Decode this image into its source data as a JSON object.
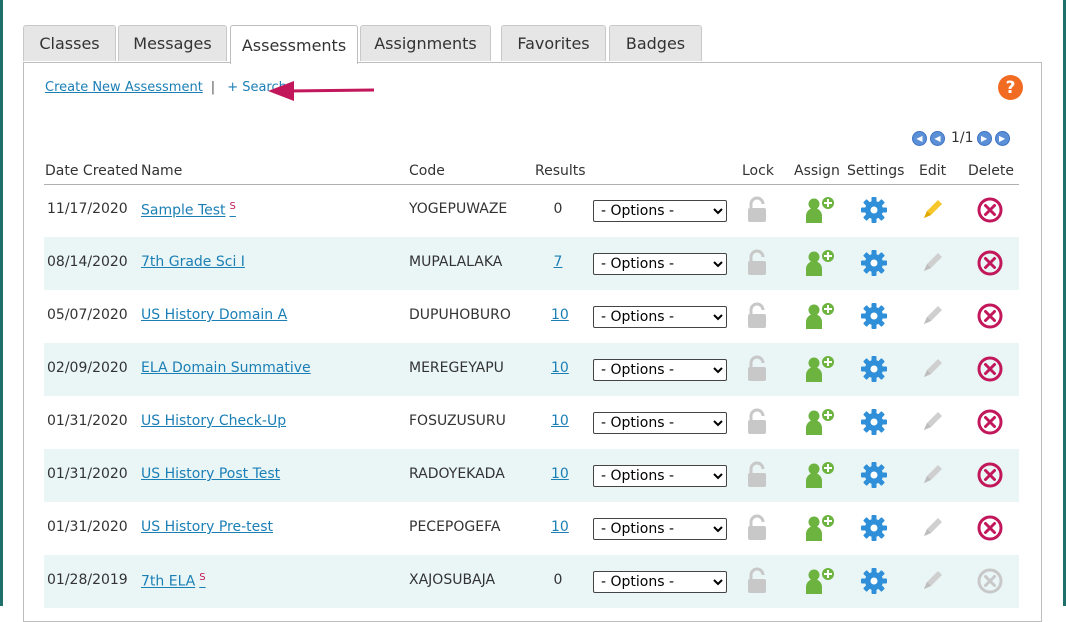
{
  "tabs": [
    "Classes",
    "Messages",
    "Assessments",
    "Assignments",
    "Favorites",
    "Badges"
  ],
  "active_tab": "Assessments",
  "links": {
    "create": "Create New Assessment",
    "separator": "|",
    "search": "+ Search"
  },
  "help": {
    "label": "?",
    "color": "#f26b22"
  },
  "pager": {
    "text": "1/1"
  },
  "columns": {
    "date": "Date Created",
    "name": "Name",
    "code": "Code",
    "results": "Results",
    "lock": "Lock",
    "assign": "Assign",
    "settings": "Settings",
    "edit": "Edit",
    "delete": "Delete"
  },
  "options_label": "- Options -",
  "colors": {
    "accent": "#1b7fb6",
    "assign": "#6cb33f",
    "settings": "#2f8fd8",
    "delete": "#c2185b",
    "edit_active": "#f6c62b",
    "arrow": "#c2185b"
  },
  "rows": [
    {
      "date": "11/17/2020",
      "name": "Sample Test",
      "sup": "S",
      "code": "YOGEPUWAZE",
      "results": "0",
      "results_link": false,
      "edit_active": true,
      "delete_active": true
    },
    {
      "date": "08/14/2020",
      "name": "7th Grade Sci I",
      "sup": "",
      "code": "MUPALALAKA",
      "results": "7",
      "results_link": true,
      "edit_active": false,
      "delete_active": true
    },
    {
      "date": "05/07/2020",
      "name": "US History Domain A",
      "sup": "",
      "code": "DUPUHOBURO",
      "results": "10",
      "results_link": true,
      "edit_active": false,
      "delete_active": true
    },
    {
      "date": "02/09/2020",
      "name": "ELA Domain Summative",
      "sup": "",
      "code": "MEREGEYAPU",
      "results": "10",
      "results_link": true,
      "edit_active": false,
      "delete_active": true
    },
    {
      "date": "01/31/2020",
      "name": "US History Check-Up",
      "sup": "",
      "code": "FOSUZUSURU",
      "results": "10",
      "results_link": true,
      "edit_active": false,
      "delete_active": true
    },
    {
      "date": "01/31/2020",
      "name": "US History Post Test",
      "sup": "",
      "code": "RADOYEKADA",
      "results": "10",
      "results_link": true,
      "edit_active": false,
      "delete_active": true
    },
    {
      "date": "01/31/2020",
      "name": "US History Pre-test",
      "sup": "",
      "code": "PECEPOGEFA",
      "results": "10",
      "results_link": true,
      "edit_active": false,
      "delete_active": true
    },
    {
      "date": "01/28/2019",
      "name": "7th ELA",
      "sup": "S",
      "code": "XAJOSUBAJA",
      "results": "0",
      "results_link": false,
      "edit_active": false,
      "delete_active": false
    }
  ]
}
